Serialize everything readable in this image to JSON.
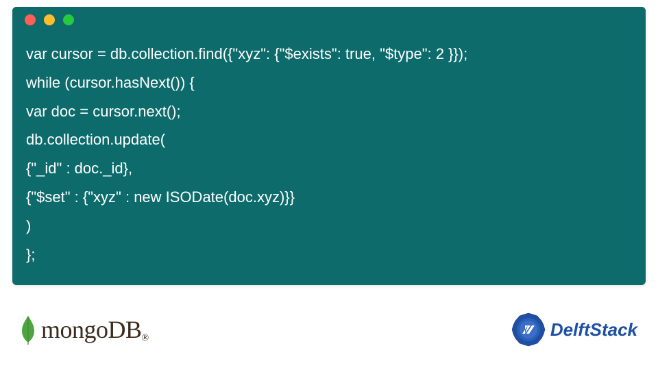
{
  "code": {
    "lines": [
      "var cursor = db.collection.find({\"xyz\": {\"$exists\": true, \"$type\": 2 }});",
      "while (cursor.hasNext()) {",
      "var doc = cursor.next();",
      "db.collection.update(",
      "{\"_id\" : doc._id},",
      "{\"$set\" : {\"xyz\" : new ISODate(doc.xyz)}}",
      ")",
      "};"
    ]
  },
  "footer": {
    "mongodb_text": "mongoDB",
    "mongodb_reg": "®",
    "delftstack_text": "DelftStack"
  },
  "colors": {
    "window_bg": "#0d6b6b",
    "code_text": "#ffffff",
    "dot_red": "#ff5f56",
    "dot_yellow": "#ffbd2e",
    "dot_green": "#27c93f",
    "mongodb_leaf": "#4da53f",
    "mongodb_text": "#3b2c1f",
    "delft_blue": "#1e4fa3"
  }
}
